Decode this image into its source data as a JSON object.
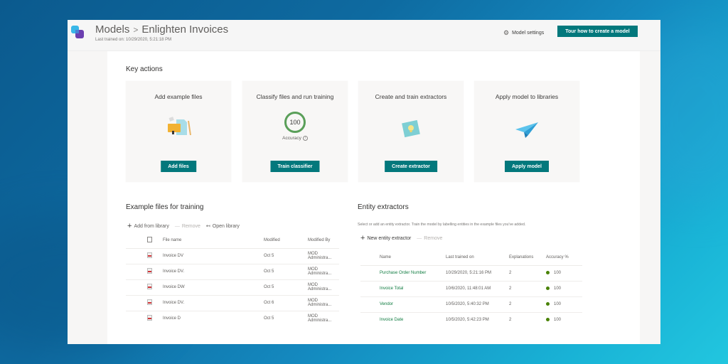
{
  "header": {
    "breadcrumb_root": "Models",
    "breadcrumb_separator": ">",
    "breadcrumb_current": "Enlighten Invoices",
    "last_trained": "Last trained on: 10/29/2020, 5:21:18 PM",
    "settings_label": "Model settings",
    "tour_button": "Tour how to create a model"
  },
  "key_actions": {
    "title": "Key actions",
    "cards": [
      {
        "title": "Add example files",
        "button": "Add files",
        "icon": "files-illustration"
      },
      {
        "title": "Classify files and run training",
        "button": "Train classifier",
        "icon": "accuracy-ring",
        "accuracy": "100",
        "accuracy_label": "Accuracy"
      },
      {
        "title": "Create and train extractors",
        "button": "Create extractor",
        "icon": "lightbulb-illustration"
      },
      {
        "title": "Apply model to libraries",
        "button": "Apply model",
        "icon": "paper-plane-illustration"
      }
    ]
  },
  "example_files": {
    "title": "Example files for training",
    "commands": {
      "add": "Add from library",
      "remove": "Remove",
      "open": "Open library"
    },
    "columns": [
      "File name",
      "Modified",
      "Modified By"
    ],
    "rows": [
      {
        "name": "Invoice DV",
        "modified": "Oct 5",
        "by": "MOD Administra..."
      },
      {
        "name": "Invoice DV.",
        "modified": "Oct 5",
        "by": "MOD Administra..."
      },
      {
        "name": "Invoice DW",
        "modified": "Oct 5",
        "by": "MOD Administra..."
      },
      {
        "name": "Invoice DV.",
        "modified": "Oct 6",
        "by": "MOD Administra..."
      },
      {
        "name": "Invoice D",
        "modified": "Oct 5",
        "by": "MOD Administra..."
      }
    ]
  },
  "entity_extractors": {
    "title": "Entity extractors",
    "description": "Select or add an entity extractor. Train the model by labelling entities in the example files you've added.",
    "commands": {
      "new": "New entity extractor",
      "remove": "Remove"
    },
    "columns": [
      "Name",
      "Last trained on",
      "Explanations",
      "Accuracy %"
    ],
    "rows": [
      {
        "name": "Purchase Order Number",
        "trained": "10/29/2020, 5:21:16 PM",
        "explanations": "2",
        "accuracy": "100"
      },
      {
        "name": "Invoice Total",
        "trained": "10/6/2020, 11:48:01 AM",
        "explanations": "2",
        "accuracy": "100"
      },
      {
        "name": "Vendor",
        "trained": "10/5/2020, 5:40:32 PM",
        "explanations": "2",
        "accuracy": "100"
      },
      {
        "name": "Invoice Date",
        "trained": "10/5/2020, 5:42:23 PM",
        "explanations": "2",
        "accuracy": "100"
      }
    ]
  },
  "colors": {
    "accent": "#03787c",
    "success": "#498205"
  }
}
